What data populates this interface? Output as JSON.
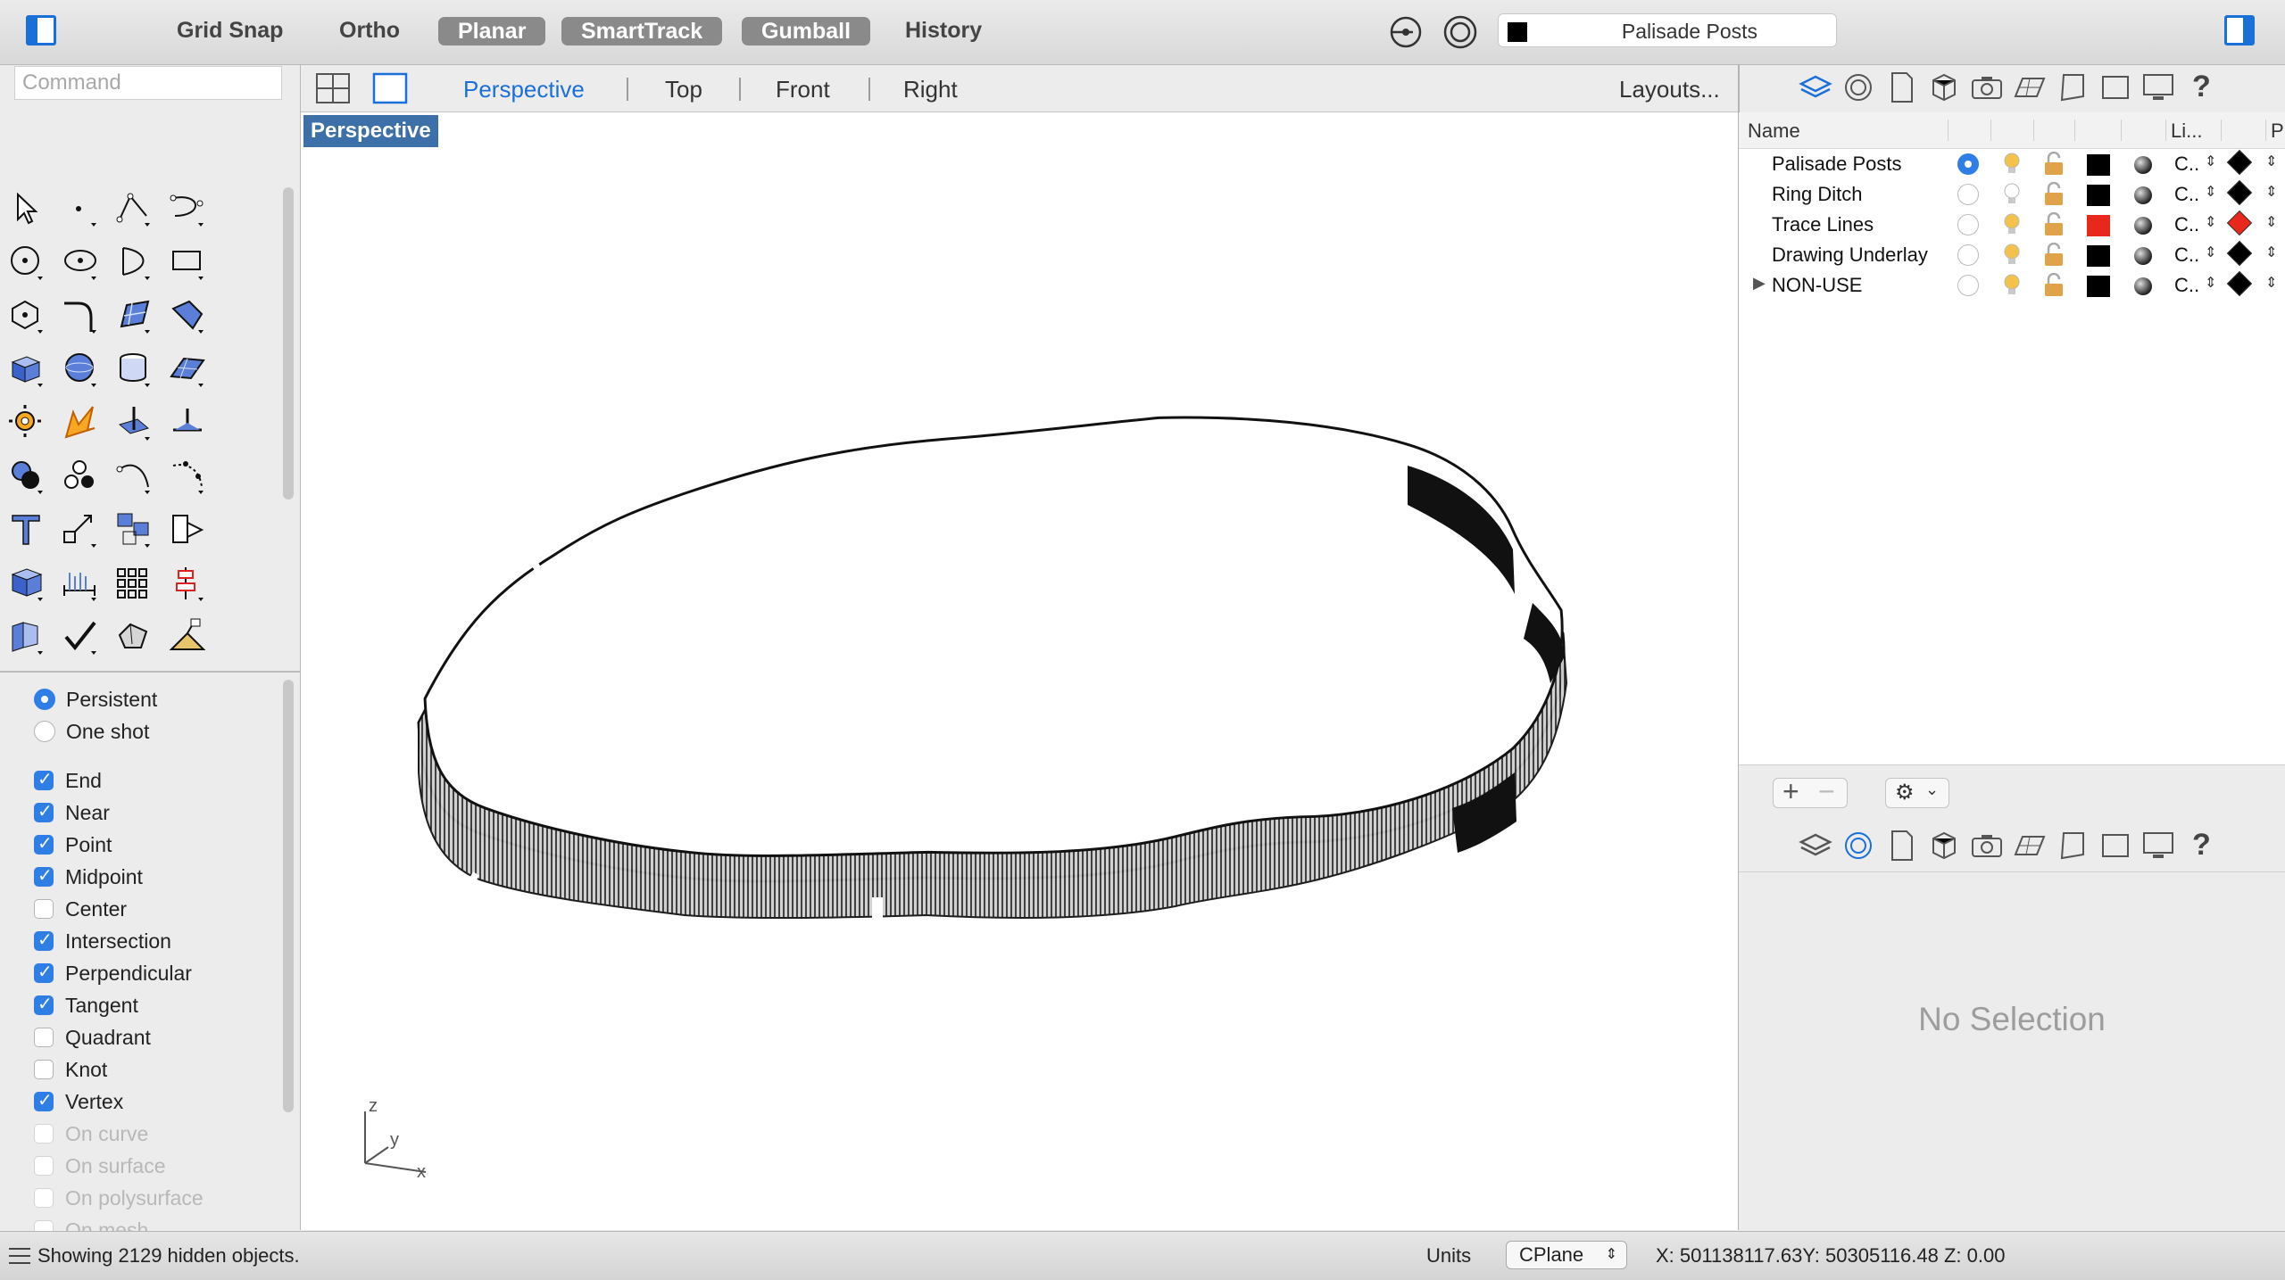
{
  "toolbar": {
    "grid_snap": "Grid Snap",
    "ortho": "Ortho",
    "planar": "Planar",
    "smarttrack": "SmartTrack",
    "gumball": "Gumball",
    "history": "History",
    "current_layer": "Palisade Posts"
  },
  "command": {
    "placeholder": "Command"
  },
  "viewport_tabs": {
    "perspective": "Perspective",
    "top": "Top",
    "front": "Front",
    "right": "Right",
    "layouts": "Layouts..."
  },
  "viewport": {
    "label": "Perspective",
    "axis_z": "z",
    "axis_y": "y",
    "axis_x": "x"
  },
  "osnap": {
    "mode": [
      "Persistent",
      "One shot"
    ],
    "items": [
      {
        "label": "End",
        "checked": true
      },
      {
        "label": "Near",
        "checked": true
      },
      {
        "label": "Point",
        "checked": true
      },
      {
        "label": "Midpoint",
        "checked": true
      },
      {
        "label": "Center",
        "checked": false
      },
      {
        "label": "Intersection",
        "checked": true
      },
      {
        "label": "Perpendicular",
        "checked": true
      },
      {
        "label": "Tangent",
        "checked": true
      },
      {
        "label": "Quadrant",
        "checked": false
      },
      {
        "label": "Knot",
        "checked": false
      },
      {
        "label": "Vertex",
        "checked": true
      },
      {
        "label": "On curve",
        "checked": false,
        "disabled": true
      },
      {
        "label": "On surface",
        "checked": false,
        "disabled": true
      },
      {
        "label": "On polysurface",
        "checked": false,
        "disabled": true
      },
      {
        "label": "On mesh",
        "checked": false,
        "disabled": true
      }
    ]
  },
  "layers": {
    "headers": {
      "name": "Name",
      "linetype": "Li...",
      "print": "P"
    },
    "rows": [
      {
        "name": "Palisade Posts",
        "current": true,
        "color": "#000000",
        "linetype": "C..",
        "print_color": "#000000"
      },
      {
        "name": "Ring Ditch",
        "current": false,
        "color": "#000000",
        "linetype": "C..",
        "print_color": "#000000"
      },
      {
        "name": "Trace Lines",
        "current": false,
        "color": "#e8281c",
        "linetype": "C..",
        "print_color": "#e8281c"
      },
      {
        "name": "Drawing Underlay",
        "current": false,
        "color": "#000000",
        "linetype": "C..",
        "print_color": "#000000"
      },
      {
        "name": "NON-USE",
        "current": false,
        "color": "#000000",
        "linetype": "C..",
        "print_color": "#000000",
        "expandable": true
      }
    ]
  },
  "properties": {
    "empty_text": "No Selection"
  },
  "status": {
    "message": "Showing 2129 hidden objects.",
    "units": "Units",
    "cplane": "CPlane",
    "coords": "X: 501138117.63Y: 50305116.48  Z: 0.00"
  }
}
